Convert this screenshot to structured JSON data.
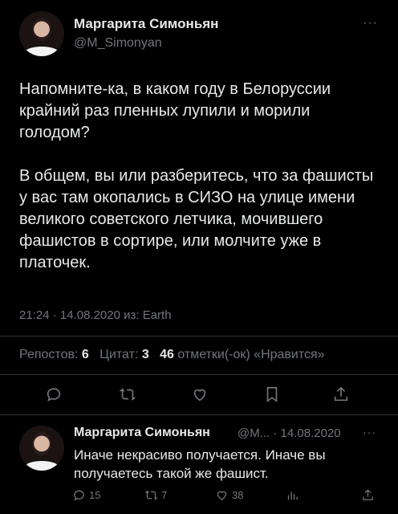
{
  "tweet": {
    "author_name": "Маргарита Симоньян",
    "author_handle": "@M_Simonyan",
    "more_label": "···",
    "text": "Напомните-ка, в каком году в Белоруссии крайний раз пленных лупили и морили голодом?\n\nВ общем, вы или разберитесь, что за фашисты у вас там окопались в СИЗО на улице имени великого советского летчика, мочившего фашистов в сортире, или молчите уже в платочек.",
    "meta": "21:24 · 14.08.2020 из: Earth"
  },
  "stats": {
    "reposts_label": "Репостов:",
    "reposts_count": "6",
    "quotes_label": "Цитат:",
    "quotes_count": "3",
    "likes_count": "46",
    "likes_label": "отметки(-ок) «Нравится»"
  },
  "actions": {
    "icons": [
      "reply-icon",
      "retweet-icon",
      "like-icon",
      "bookmark-icon",
      "share-icon"
    ]
  },
  "reply": {
    "author_name": "Маргарита Симоньян",
    "handle_date": "@M... · 14.08.2020",
    "more_label": "···",
    "text": "Иначе некрасиво получается. Иначе вы получаетесь такой же фашист.",
    "replies": "15",
    "retweets": "7",
    "likes": "38"
  },
  "colors": {
    "background": "#000000",
    "text": "#e7e9ea",
    "muted": "#71767b",
    "divider": "#2f3336"
  }
}
